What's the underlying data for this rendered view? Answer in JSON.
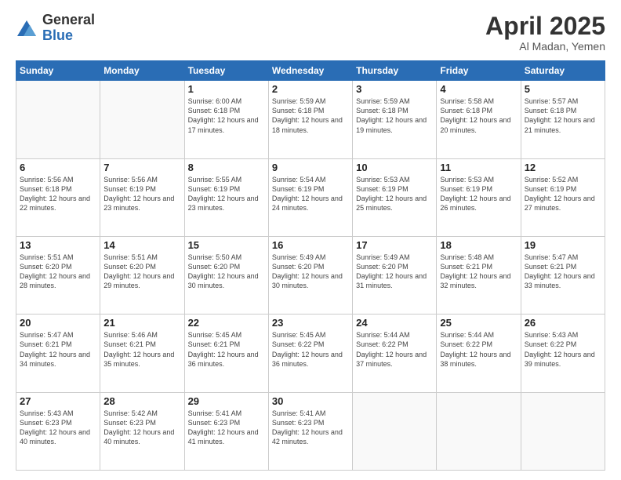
{
  "header": {
    "logo_general": "General",
    "logo_blue": "Blue",
    "month_title": "April 2025",
    "subtitle": "Al Madan, Yemen"
  },
  "days_of_week": [
    "Sunday",
    "Monday",
    "Tuesday",
    "Wednesday",
    "Thursday",
    "Friday",
    "Saturday"
  ],
  "weeks": [
    [
      {
        "day": "",
        "info": ""
      },
      {
        "day": "",
        "info": ""
      },
      {
        "day": "1",
        "info": "Sunrise: 6:00 AM\nSunset: 6:18 PM\nDaylight: 12 hours and 17 minutes."
      },
      {
        "day": "2",
        "info": "Sunrise: 5:59 AM\nSunset: 6:18 PM\nDaylight: 12 hours and 18 minutes."
      },
      {
        "day": "3",
        "info": "Sunrise: 5:59 AM\nSunset: 6:18 PM\nDaylight: 12 hours and 19 minutes."
      },
      {
        "day": "4",
        "info": "Sunrise: 5:58 AM\nSunset: 6:18 PM\nDaylight: 12 hours and 20 minutes."
      },
      {
        "day": "5",
        "info": "Sunrise: 5:57 AM\nSunset: 6:18 PM\nDaylight: 12 hours and 21 minutes."
      }
    ],
    [
      {
        "day": "6",
        "info": "Sunrise: 5:56 AM\nSunset: 6:18 PM\nDaylight: 12 hours and 22 minutes."
      },
      {
        "day": "7",
        "info": "Sunrise: 5:56 AM\nSunset: 6:19 PM\nDaylight: 12 hours and 23 minutes."
      },
      {
        "day": "8",
        "info": "Sunrise: 5:55 AM\nSunset: 6:19 PM\nDaylight: 12 hours and 23 minutes."
      },
      {
        "day": "9",
        "info": "Sunrise: 5:54 AM\nSunset: 6:19 PM\nDaylight: 12 hours and 24 minutes."
      },
      {
        "day": "10",
        "info": "Sunrise: 5:53 AM\nSunset: 6:19 PM\nDaylight: 12 hours and 25 minutes."
      },
      {
        "day": "11",
        "info": "Sunrise: 5:53 AM\nSunset: 6:19 PM\nDaylight: 12 hours and 26 minutes."
      },
      {
        "day": "12",
        "info": "Sunrise: 5:52 AM\nSunset: 6:19 PM\nDaylight: 12 hours and 27 minutes."
      }
    ],
    [
      {
        "day": "13",
        "info": "Sunrise: 5:51 AM\nSunset: 6:20 PM\nDaylight: 12 hours and 28 minutes."
      },
      {
        "day": "14",
        "info": "Sunrise: 5:51 AM\nSunset: 6:20 PM\nDaylight: 12 hours and 29 minutes."
      },
      {
        "day": "15",
        "info": "Sunrise: 5:50 AM\nSunset: 6:20 PM\nDaylight: 12 hours and 30 minutes."
      },
      {
        "day": "16",
        "info": "Sunrise: 5:49 AM\nSunset: 6:20 PM\nDaylight: 12 hours and 30 minutes."
      },
      {
        "day": "17",
        "info": "Sunrise: 5:49 AM\nSunset: 6:20 PM\nDaylight: 12 hours and 31 minutes."
      },
      {
        "day": "18",
        "info": "Sunrise: 5:48 AM\nSunset: 6:21 PM\nDaylight: 12 hours and 32 minutes."
      },
      {
        "day": "19",
        "info": "Sunrise: 5:47 AM\nSunset: 6:21 PM\nDaylight: 12 hours and 33 minutes."
      }
    ],
    [
      {
        "day": "20",
        "info": "Sunrise: 5:47 AM\nSunset: 6:21 PM\nDaylight: 12 hours and 34 minutes."
      },
      {
        "day": "21",
        "info": "Sunrise: 5:46 AM\nSunset: 6:21 PM\nDaylight: 12 hours and 35 minutes."
      },
      {
        "day": "22",
        "info": "Sunrise: 5:45 AM\nSunset: 6:21 PM\nDaylight: 12 hours and 36 minutes."
      },
      {
        "day": "23",
        "info": "Sunrise: 5:45 AM\nSunset: 6:22 PM\nDaylight: 12 hours and 36 minutes."
      },
      {
        "day": "24",
        "info": "Sunrise: 5:44 AM\nSunset: 6:22 PM\nDaylight: 12 hours and 37 minutes."
      },
      {
        "day": "25",
        "info": "Sunrise: 5:44 AM\nSunset: 6:22 PM\nDaylight: 12 hours and 38 minutes."
      },
      {
        "day": "26",
        "info": "Sunrise: 5:43 AM\nSunset: 6:22 PM\nDaylight: 12 hours and 39 minutes."
      }
    ],
    [
      {
        "day": "27",
        "info": "Sunrise: 5:43 AM\nSunset: 6:23 PM\nDaylight: 12 hours and 40 minutes."
      },
      {
        "day": "28",
        "info": "Sunrise: 5:42 AM\nSunset: 6:23 PM\nDaylight: 12 hours and 40 minutes."
      },
      {
        "day": "29",
        "info": "Sunrise: 5:41 AM\nSunset: 6:23 PM\nDaylight: 12 hours and 41 minutes."
      },
      {
        "day": "30",
        "info": "Sunrise: 5:41 AM\nSunset: 6:23 PM\nDaylight: 12 hours and 42 minutes."
      },
      {
        "day": "",
        "info": ""
      },
      {
        "day": "",
        "info": ""
      },
      {
        "day": "",
        "info": ""
      }
    ]
  ]
}
